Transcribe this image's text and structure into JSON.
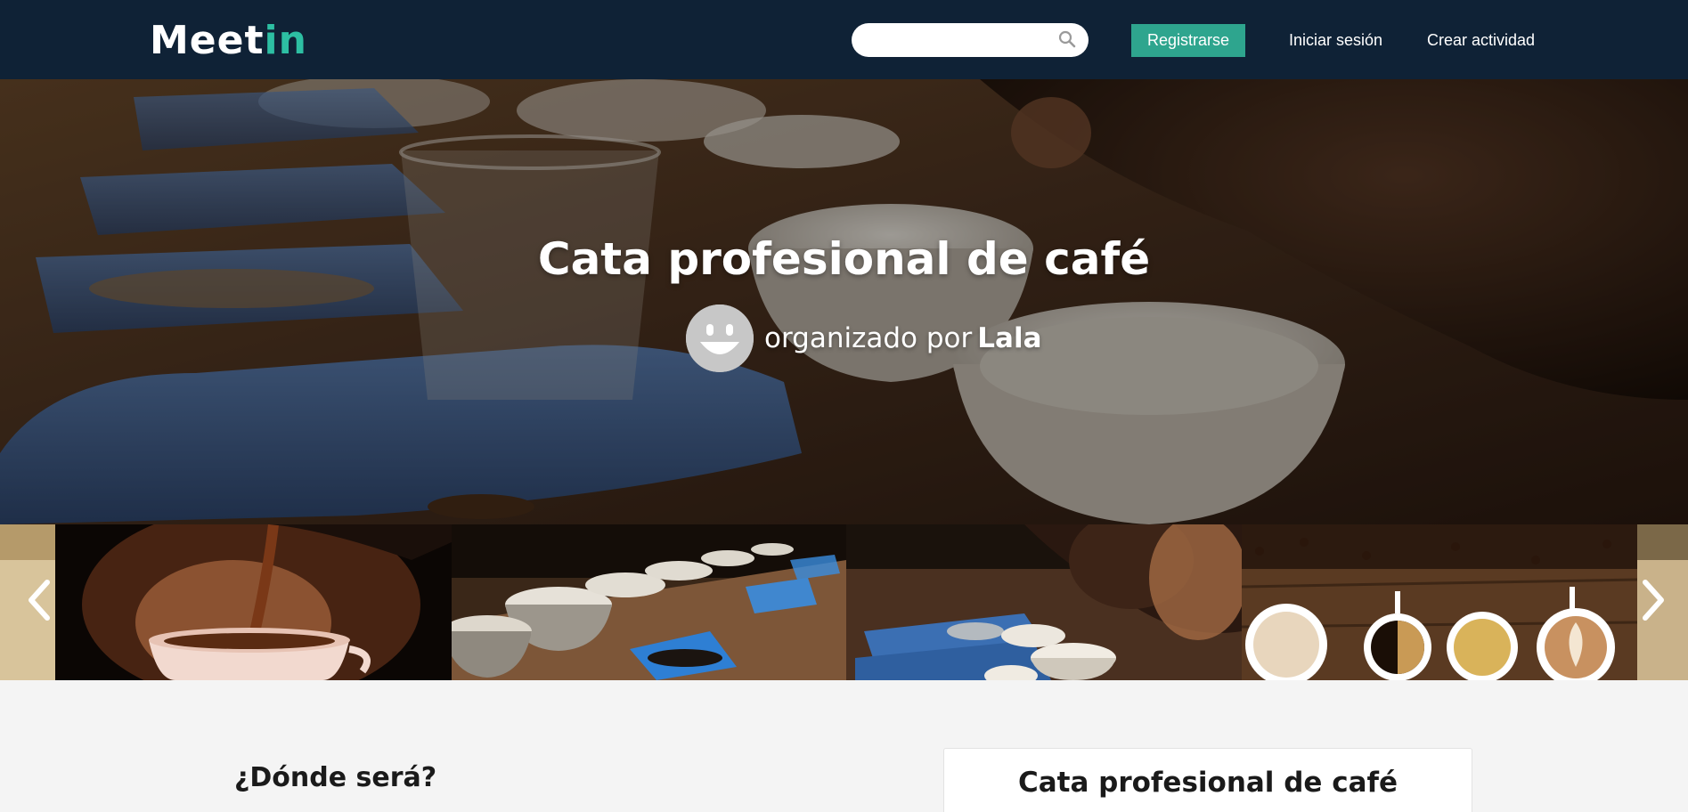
{
  "header": {
    "logo": {
      "part1": "Mee",
      "part2": "t",
      "part3": "in"
    },
    "search": {
      "value": "",
      "placeholder": ""
    },
    "register_label": "Registrarse",
    "login_label": "Iniciar sesión",
    "create_activity_label": "Crear actividad"
  },
  "hero": {
    "title": "Cata profesional de café",
    "organized_by": "organizado por",
    "organizer_name": "Lala"
  },
  "carousel": {
    "slides": [
      "coffee-pouring",
      "cupping-bowls",
      "man-smelling-coffee",
      "coffee-cups-and-beans"
    ]
  },
  "content": {
    "where_heading": "¿Dónde será?",
    "event_card_title": "Cata profesional de café"
  },
  "colors": {
    "header_bg": "#0f2236",
    "accent": "#2dbfa3",
    "register_button": "#2ea58e"
  }
}
